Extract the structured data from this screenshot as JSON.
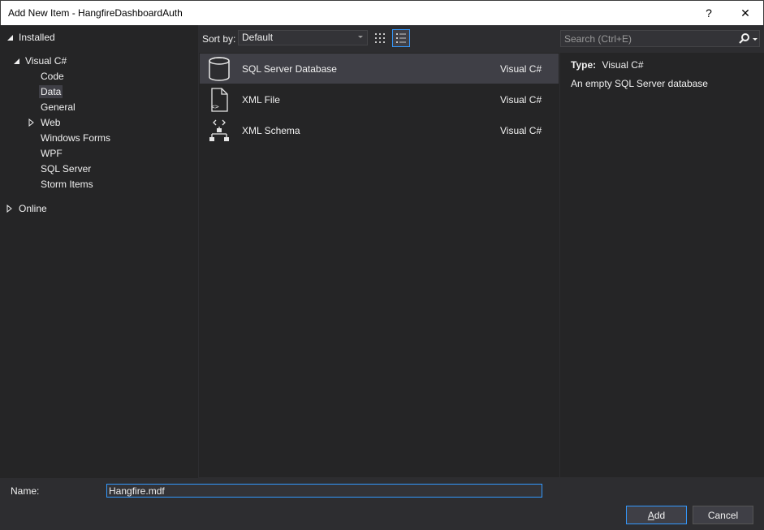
{
  "window": {
    "title": "Add New Item - HangfireDashboardAuth",
    "help_label": "?",
    "close_label": "✕"
  },
  "tree": {
    "installed": "Installed",
    "visual_csharp": "Visual C#",
    "children": [
      "Code",
      "Data",
      "General",
      "Web",
      "Windows Forms",
      "WPF",
      "SQL Server",
      "Storm Items"
    ],
    "selected": "Data",
    "online": "Online"
  },
  "toolbar": {
    "sort_by_label": "Sort by:",
    "sort_value": "Default"
  },
  "templates": [
    {
      "name": "SQL Server Database",
      "lang": "Visual C#",
      "icon": "database-icon",
      "selected": true
    },
    {
      "name": "XML File",
      "lang": "Visual C#",
      "icon": "xml-file-icon",
      "selected": false
    },
    {
      "name": "XML Schema",
      "lang": "Visual C#",
      "icon": "xml-schema-icon",
      "selected": false
    }
  ],
  "search": {
    "placeholder": "Search (Ctrl+E)"
  },
  "details": {
    "type_key": "Type:",
    "type_value": "Visual C#",
    "description": "An empty SQL Server database"
  },
  "footer": {
    "name_label": "Name:",
    "name_value": "Hangfire.mdf",
    "add_label_accel": "A",
    "add_label_rest": "dd",
    "cancel_label": "Cancel"
  },
  "colors": {
    "background": "#2d2d30",
    "panel": "#252526",
    "selection": "#3f3f46",
    "accent": "#3399ff",
    "text": "#f1f1f1"
  }
}
